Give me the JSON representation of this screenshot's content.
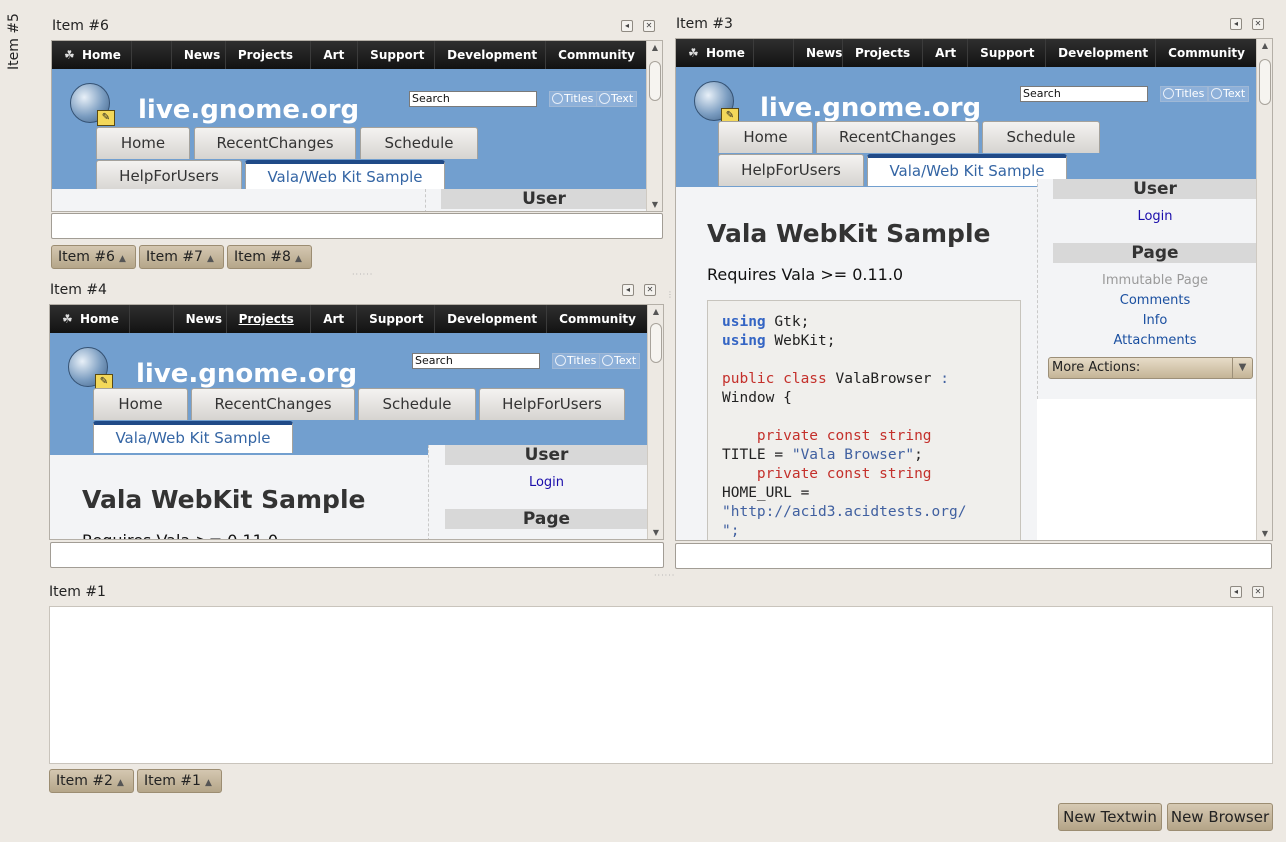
{
  "side_dock": {
    "label": "Item #5"
  },
  "nav": {
    "items": [
      "Home",
      "News",
      "Projects",
      "Art",
      "Support",
      "Development",
      "Community"
    ]
  },
  "site": {
    "name": "live.gnome.org",
    "search_value": "Search",
    "titles_btn": "Titles",
    "text_btn": "Text"
  },
  "wiki_tabs": [
    "Home",
    "RecentChanges",
    "Schedule",
    "HelpForUsers",
    "Vala/Web Kit Sample"
  ],
  "sidebar": {
    "user_heading": "User",
    "login": "Login",
    "page_heading": "Page",
    "immutable": "Immutable Page",
    "comments": "Comments",
    "info": "Info",
    "attachments": "Attachments",
    "more_actions": "More Actions:"
  },
  "article": {
    "title": "Vala WebKit Sample",
    "requires": "Requires Vala >= 0.11.0",
    "code": {
      "l1_kw": "using",
      "l1_rest": " Gtk;",
      "l2_kw": "using",
      "l2_rest": " WebKit;",
      "l4_a": "public class",
      "l4_b": " ValaBrowser ",
      "l4_c": ":",
      "l5": "Window {",
      "l7_indent": "    ",
      "l7_a": "private const",
      "l7_b": " string",
      "l8_a": "TITLE = ",
      "l8_b": "\"Vala Browser\"",
      "l8_c": ";",
      "l9_indent": "    ",
      "l9_a": "private const",
      "l9_b": " string",
      "l10": "HOME_URL =",
      "l11": "\"http://acid3.acidtests.org/",
      "l12": "\";"
    }
  },
  "docks": {
    "item6": {
      "title": "Item #6"
    },
    "item3": {
      "title": "Item #3"
    },
    "item4": {
      "title": "Item #4"
    },
    "item1": {
      "title": "Item #1"
    }
  },
  "tab_groups": {
    "top_left": [
      "Item #6",
      "Item #7",
      "Item #8"
    ],
    "bottom": [
      "Item #2",
      "Item #1"
    ]
  },
  "buttons": {
    "new_textwin": "New Textwin",
    "new_browser": "New Browser"
  },
  "icons": {
    "dock_restore": "iconify-icon",
    "dock_close": "close-icon",
    "tab_arrow": "up-triangle-icon"
  }
}
